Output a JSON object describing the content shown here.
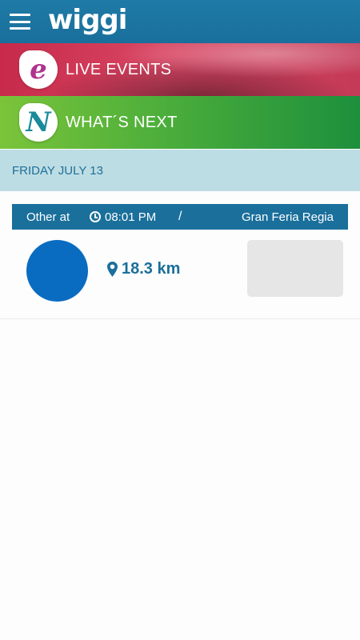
{
  "app": {
    "logo": "wiggi"
  },
  "banners": {
    "live": {
      "label": "LIVE EVENTS",
      "icon_letter": "e"
    },
    "next": {
      "label": "WHAT´S NEXT",
      "icon_letter": "N"
    }
  },
  "date_header": "FRIDAY JULY 13",
  "events": [
    {
      "category": "Other at",
      "time": "08:01 PM",
      "separator": "/",
      "venue": "Gran Feria Regia",
      "distance": "18.3 km",
      "avatar_color": "#0a6cc1"
    }
  ],
  "icons": {
    "menu": "hamburger-menu-icon",
    "clock": "clock-icon",
    "location": "location-pin-icon"
  },
  "colors": {
    "primary": "#1a6f9b",
    "date_bar": "#bddde4",
    "live_banner": "#d84663",
    "next_banner": "#4cae3b"
  }
}
